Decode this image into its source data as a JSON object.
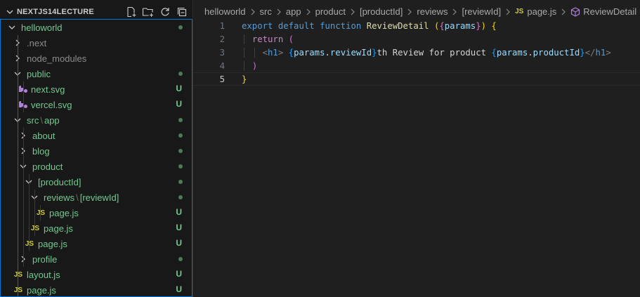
{
  "explorer": {
    "title": "NEXTJS14LECTURE",
    "actions": [
      "new-file-icon",
      "new-folder-icon",
      "refresh-icon",
      "collapse-all-icon"
    ],
    "tree": [
      {
        "label": "helloworld",
        "type": "folder",
        "open": true,
        "depth": 0,
        "status": "dot",
        "green": true
      },
      {
        "label": ".next",
        "type": "folder",
        "open": false,
        "depth": 1,
        "status": "",
        "muted": true
      },
      {
        "label": "node_modules",
        "type": "folder",
        "open": false,
        "depth": 1,
        "status": "",
        "muted": true
      },
      {
        "label": "public",
        "type": "folder",
        "open": true,
        "depth": 1,
        "status": "dot",
        "green": true
      },
      {
        "label": "next.svg",
        "type": "svg",
        "depth": 2,
        "status": "U",
        "green": true
      },
      {
        "label": "vercel.svg",
        "type": "svg",
        "depth": 2,
        "status": "U",
        "green": true
      },
      {
        "label": "src",
        "label2": "app",
        "type": "folder",
        "open": true,
        "depth": 1,
        "status": "dot",
        "green": true
      },
      {
        "label": "about",
        "type": "folder",
        "open": false,
        "depth": 2,
        "status": "dot",
        "green": true
      },
      {
        "label": "blog",
        "type": "folder",
        "open": false,
        "depth": 2,
        "status": "dot",
        "green": true
      },
      {
        "label": "product",
        "type": "folder",
        "open": true,
        "depth": 2,
        "status": "dot",
        "green": true
      },
      {
        "label": "[productId]",
        "type": "folder",
        "open": true,
        "depth": 3,
        "status": "dot",
        "green": true
      },
      {
        "label": "reviews",
        "label2": "[reviewId]",
        "type": "folder",
        "open": true,
        "depth": 4,
        "status": "dot",
        "green": true
      },
      {
        "label": "page.js",
        "type": "js",
        "depth": 5,
        "status": "U",
        "green": true
      },
      {
        "label": "page.js",
        "type": "js",
        "depth": 4,
        "status": "U",
        "green": true
      },
      {
        "label": "page.js",
        "type": "js",
        "depth": 3,
        "status": "U",
        "green": true
      },
      {
        "label": "profile",
        "type": "folder",
        "open": false,
        "depth": 2,
        "status": "dot",
        "green": true
      },
      {
        "label": "layout.js",
        "type": "js",
        "depth": 1,
        "status": "U",
        "green": true
      },
      {
        "label": "page.js",
        "type": "js",
        "depth": 1,
        "status": "U",
        "green": true
      }
    ]
  },
  "breadcrumbs": {
    "items": [
      "helloworld",
      "src",
      "app",
      "product",
      "[productId]",
      "reviews",
      "[reviewId]"
    ],
    "file_badge": "JS",
    "file": "page.js",
    "symbol": "ReviewDetail"
  },
  "editor": {
    "lines": [
      {
        "n": "1"
      },
      {
        "n": "2"
      },
      {
        "n": "3"
      },
      {
        "n": "4"
      },
      {
        "n": "5"
      }
    ],
    "code": {
      "l1_export": "export",
      "l1_default": "default",
      "l1_function": "function",
      "l1_name": "ReviewDetail",
      "l1_params": "params",
      "l2_return": "return",
      "l3_tag": "h1",
      "l3_params1": "params",
      "l3_prop1": "reviewId",
      "l3_text": "th Review for product ",
      "l3_params2": "params",
      "l3_prop2": "productId"
    }
  },
  "colors": {
    "accent": "#0078d4",
    "untracked": "#73c991",
    "js_badge": "#cbcb41"
  }
}
